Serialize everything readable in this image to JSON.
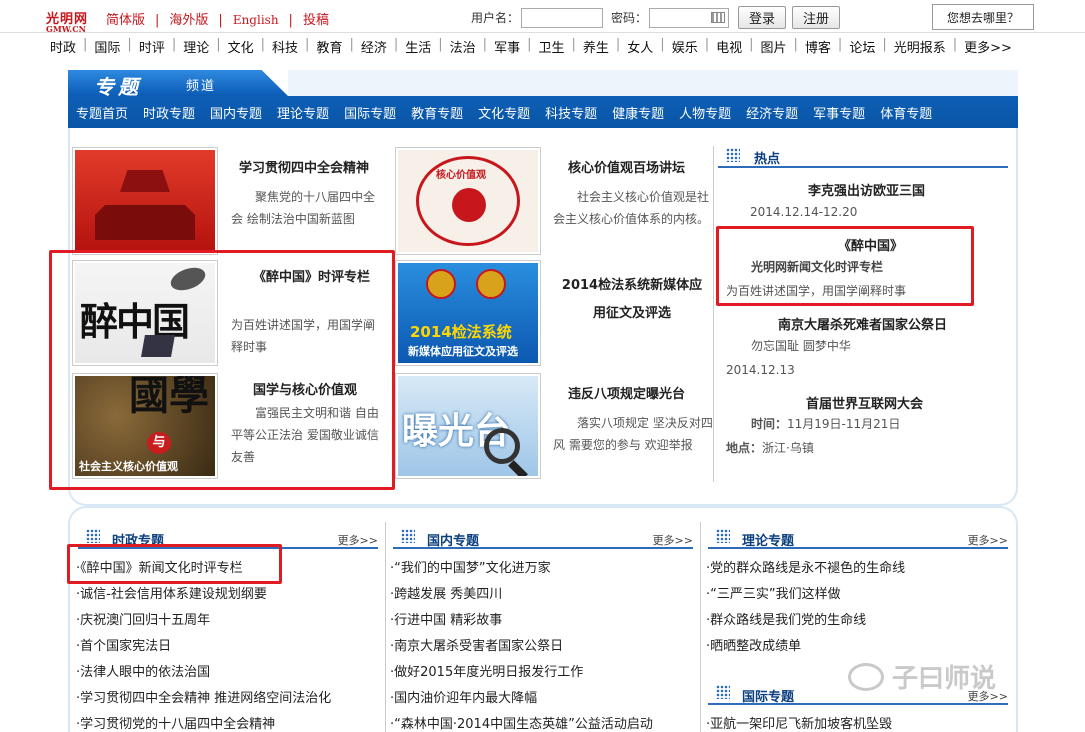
{
  "header": {
    "logo_text": "光明网",
    "logo_sub": "GMW.CN",
    "links": [
      "简体版",
      "海外版",
      "English",
      "投稿"
    ],
    "username_label": "用户名：",
    "password_label": "密码：",
    "login_button": "登录",
    "register_button": "注册",
    "where_button": "您想去哪里？"
  },
  "channels": [
    "时政",
    "国际",
    "时评",
    "理论",
    "文化",
    "科技",
    "教育",
    "经济",
    "生活",
    "法治",
    "军事",
    "卫生",
    "养生",
    "女人",
    "娱乐",
    "电视",
    "图片",
    "博客",
    "论坛",
    "光明报系",
    "更多>>"
  ],
  "banner": {
    "title": "专题",
    "subtitle": "频道",
    "nav": [
      "专题首页",
      "时政专题",
      "国内专题",
      "理论专题",
      "国际专题",
      "教育专题",
      "文化专题",
      "科技专题",
      "健康专题",
      "人物专题",
      "经济专题",
      "军事专题",
      "体育专题"
    ]
  },
  "features": {
    "f1": {
      "title": "学习贯彻四中全会精神",
      "desc": "聚焦党的十八届四中全会 绘制法治中国新蓝图"
    },
    "f2": {
      "title": "《醉中国》时评专栏",
      "desc": "为百姓讲述国学，用国学阐释时事",
      "img_text": "醉中国"
    },
    "f3": {
      "title": "国学与核心价值观",
      "desc": "富强民主文明和谐 自由平等公正法治 爱国敬业诚信友善",
      "img_text1": "國學",
      "img_text2": "与",
      "img_text3": "社会主义核心价值观"
    },
    "f4": {
      "title": "核心价值观百场讲坛",
      "desc": "社会主义核心价值观是社会主义核心价值体系的内核。",
      "img_text": "核心价值观"
    },
    "f5": {
      "title": "2014检法系统新媒体应用征文及评选",
      "img_text1": "2014检法系统",
      "img_text2": "新媒体应用征文及评选"
    },
    "f6": {
      "title": "违反八项规定曝光台",
      "desc": "落实八项规定 坚决反对四风 需要您的参与 欢迎举报",
      "img_text": "曝光台"
    }
  },
  "hot": {
    "label": "热点",
    "items": [
      {
        "title": "李克强出访欧亚三国",
        "sub": "2014.12.14-12.20"
      },
      {
        "title": "《醉中国》",
        "sub": "光明网新闻文化时评专栏",
        "sub2": "为百姓讲述国学，用国学阐释时事"
      },
      {
        "title": "南京大屠杀死难者国家公祭日",
        "sub": "勿忘国耻 圆梦中华",
        "sub2": "2014.12.13"
      },
      {
        "title": "首届世界互联网大会",
        "time_label": "时间：",
        "time": "11月19日-11月21日",
        "place_label": "地点：",
        "place": "浙江·乌镇"
      }
    ]
  },
  "sections": {
    "more": "更多>>",
    "shizheng": {
      "label": "时政专题",
      "items": [
        "·《醉中国》新闻文化时评专栏",
        "·诚信-社会信用体系建设规划纲要",
        "·庆祝澳门回归十五周年",
        "·首个国家宪法日",
        "·法律人眼中的依法治国",
        "·学习贯彻四中全会精神 推进网络空间法治化",
        "·学习贯彻党的十八届四中全会精神"
      ]
    },
    "guonei": {
      "label": "国内专题",
      "items": [
        "·“我们的中国梦”文化进万家",
        "·跨越发展 秀美四川",
        "·行进中国 精彩故事",
        "·南京大屠杀受害者国家公祭日",
        "·做好2015年度光明日报发行工作",
        "·国内油价迎年内最大降幅",
        "·“森林中国·2014中国生态英雄”公益活动启动"
      ]
    },
    "lilun": {
      "label": "理论专题",
      "items": [
        "·党的群众路线是永不褪色的生命线",
        "·“三严三实”我们这样做",
        "·群众路线是我们党的生命线",
        "·晒晒整改成绩单"
      ]
    },
    "guoji": {
      "label": "国际专题",
      "items": [
        "·亚航一架印尼飞新加坡客机坠毁"
      ]
    }
  },
  "watermark": "子曰师说"
}
